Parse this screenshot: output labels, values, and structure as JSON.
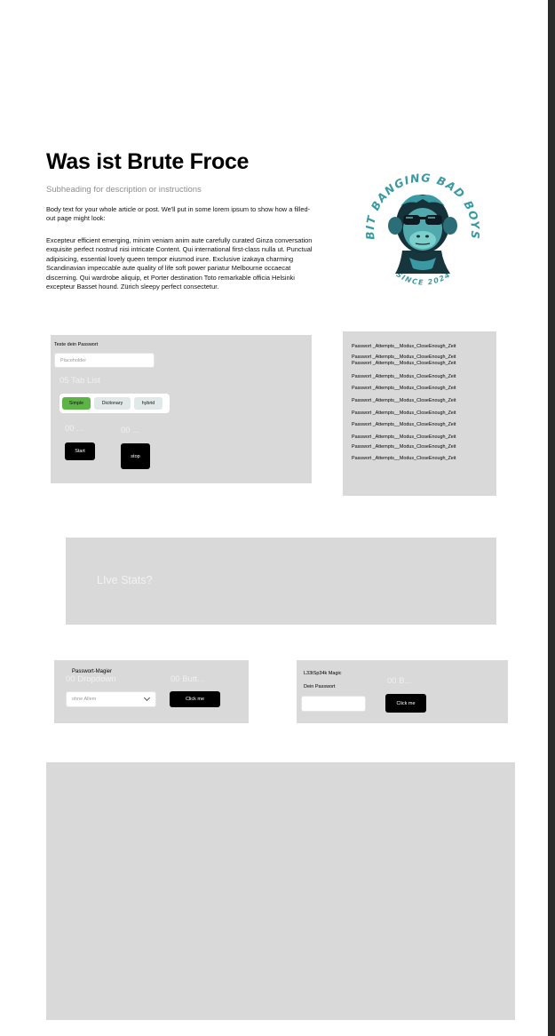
{
  "header": {
    "title": "Was ist Brute Froce",
    "subheading": "Subheading for description or instructions",
    "body_paragraph_1": "Body text for your whole article or post. We'll put in some lorem ipsum to show how a filled-out page might look:",
    "body_paragraph_2": "Excepteur efficient emerging, minim veniam anim aute carefully curated Ginza conversation exquisite perfect nostrud nisi intricate Content. Qui  international first-class nulla ut. Punctual adipisicing, essential lovely queen tempor eiusmod irure. Exclusive izakaya charming Scandinavian impeccable aute quality of life soft power pariatur Melbourne occaecat discerning. Qui wardrobe aliquip, et Porter destination Toto remarkable officia Helsinki excepteur Basset hound. Zürich sleepy perfect consectetur."
  },
  "logo": {
    "arc_top": "BIT BANGING BAD BOYS",
    "arc_bottom": "SINCE 2024",
    "colors": {
      "teal": "#3a9aa3",
      "dark": "#15323a",
      "light_teal": "#7cd0cc"
    }
  },
  "test_panel": {
    "label": "Teste dein Passwort",
    "input_placeholder": "Placeholder",
    "tab_list_label": "05 Tab List",
    "tabs": [
      "Simple",
      "Dicitonary",
      "hybrid"
    ],
    "selected_tab": "Simple",
    "button_group_1_label": "00 ...",
    "button_group_2_label": "00 ...",
    "start_label": "Start",
    "stop_label": "stop",
    "selected_color": "#5db446"
  },
  "log_panel": {
    "lines": [
      "Passwort _Attempts__Modus_CloseEnough_Zeit",
      "Passwort _Attempts__Modus_CloseEnough_Zeit",
      "Passwort _Attempts__Modus_CloseEnough_Zeit",
      "Passwort _Attempts__Modus_CloseEnough_Zeit",
      "Passwort _Attempts__Modus_CloseEnough_Zeit",
      "Passwort _Attempts__Modus_CloseEnough_Zeit",
      "Passwort _Attempts__Modus_CloseEnough_Zeit",
      "Passwort _Attempts__Modus_CloseEnough_Zeit",
      "Passwort _Attempts__Modus_CloseEnough_Zeit",
      "Passwort _Attempts__Modus_CloseEnough_Zeit",
      "Passwort _Attempts__Modus_CloseEnough_Zeit"
    ]
  },
  "stats_panel": {
    "label": "LIve Stats?"
  },
  "magier_panel": {
    "title": "Passwort-Magier",
    "dropdown_label": "00 Dropdown",
    "button_group_label": "00 Butt...",
    "select_value": "ohne Allem",
    "button_label": "Click me"
  },
  "leet_panel": {
    "title": "L33tSp34k Magic",
    "field_label": "Dein Passwort",
    "button_group_label": "00 B...",
    "button_label": "Click me"
  }
}
